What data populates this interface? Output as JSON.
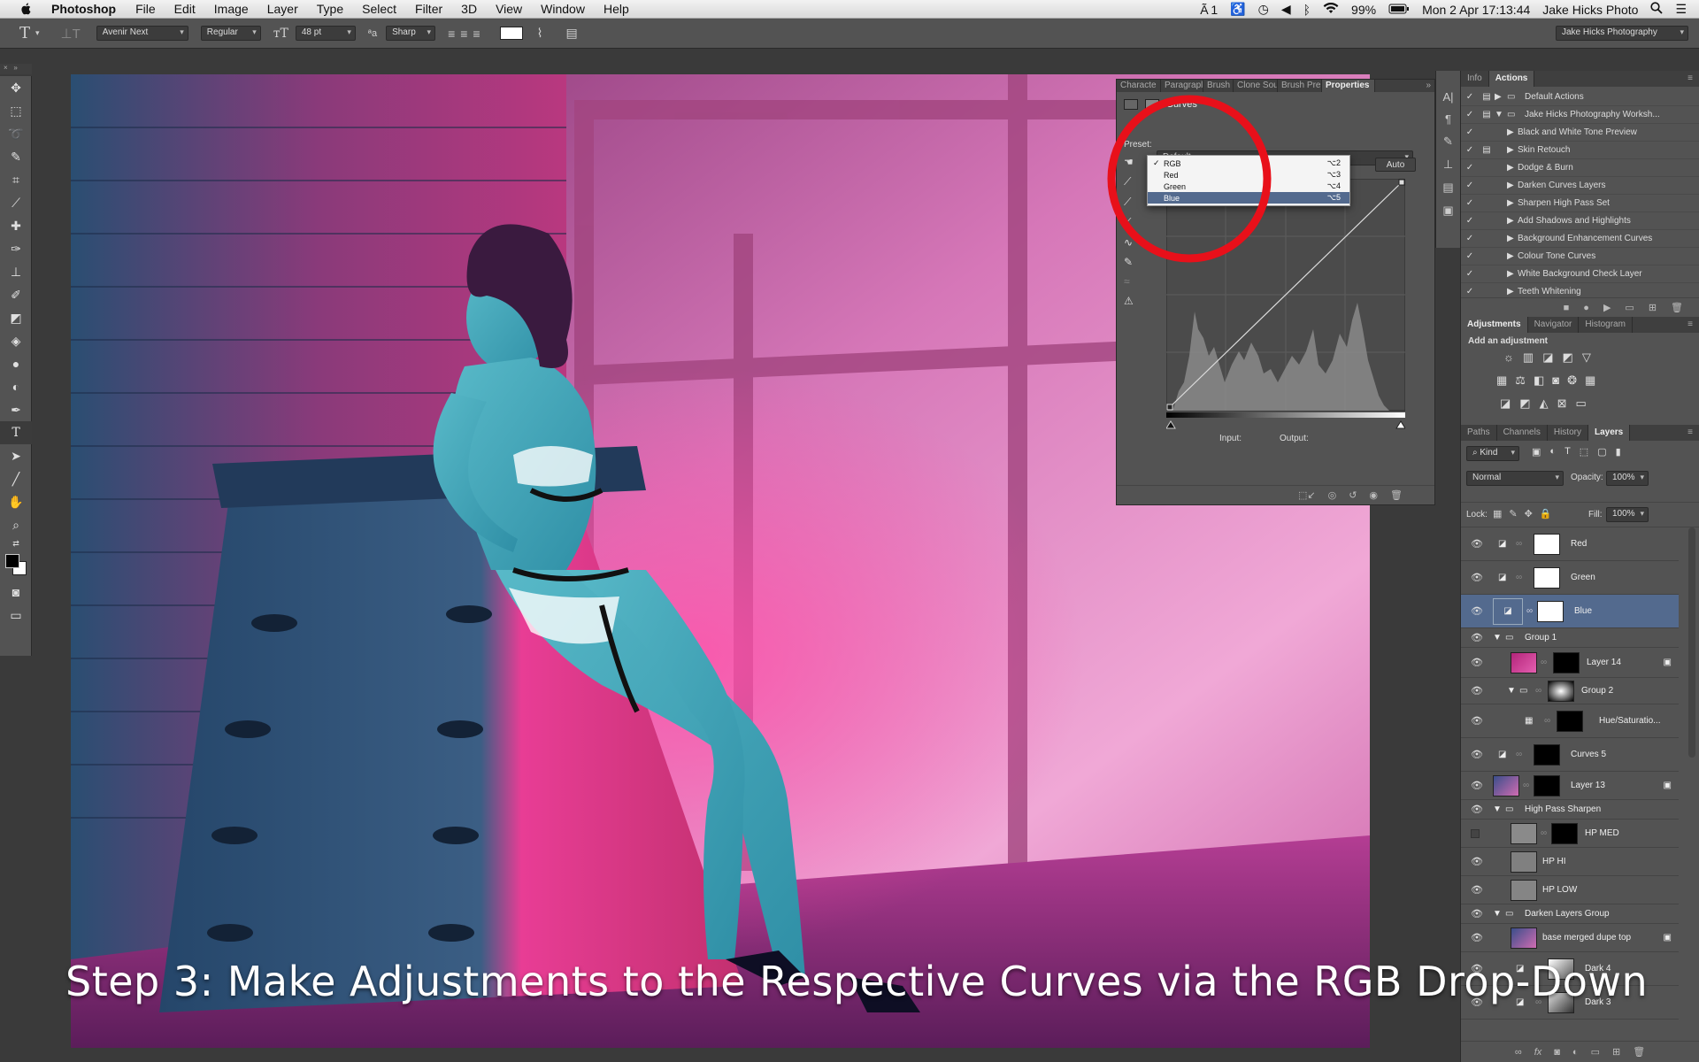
{
  "menubar": {
    "app_name": "Photoshop",
    "items": [
      "File",
      "Edit",
      "Image",
      "Layer",
      "Type",
      "Select",
      "Filter",
      "3D",
      "View",
      "Window",
      "Help"
    ],
    "status": {
      "indicator": "1",
      "battery": "99%",
      "clock": "Mon 2 Apr  17:13:44",
      "user": "Jake Hicks Photo"
    }
  },
  "options_bar": {
    "font_family": "Avenir Next",
    "font_style": "Regular",
    "font_size": "48 pt",
    "aa_label": "ªa",
    "anti_alias": "Sharp",
    "workspace": "Jake Hicks Photography"
  },
  "properties_panel": {
    "tabs": [
      "Characte",
      "Paragrapl",
      "Brush",
      "Clone Sou",
      "Brush Pre",
      "Properties"
    ],
    "active_tab": "Properties",
    "title": "Curves",
    "preset_label": "Preset:",
    "preset_value": "Default",
    "auto_label": "Auto",
    "input_label": "Input:",
    "output_label": "Output:",
    "channel_dropdown": [
      {
        "label": "RGB",
        "shortcut": "⌥2",
        "checked": true
      },
      {
        "label": "Red",
        "shortcut": "⌥3",
        "checked": false
      },
      {
        "label": "Green",
        "shortcut": "⌥4",
        "checked": false
      },
      {
        "label": "Blue",
        "shortcut": "⌥5",
        "checked": false,
        "highlighted": true
      }
    ]
  },
  "actions_panel": {
    "tabs": [
      "Info",
      "Actions"
    ],
    "active_tab": "Actions",
    "items": [
      {
        "label": "Default Actions",
        "kind": "set",
        "expanded": false
      },
      {
        "label": "Jake Hicks Photography Worksh...",
        "kind": "set",
        "expanded": true
      },
      {
        "label": "Black and White Tone Preview",
        "kind": "action"
      },
      {
        "label": "Skin Retouch",
        "kind": "action"
      },
      {
        "label": "Dodge & Burn",
        "kind": "action"
      },
      {
        "label": "Darken Curves Layers",
        "kind": "action"
      },
      {
        "label": "Sharpen High Pass Set",
        "kind": "action"
      },
      {
        "label": "Add Shadows and Highlights",
        "kind": "action"
      },
      {
        "label": "Background Enhancement Curves",
        "kind": "action"
      },
      {
        "label": "Colour Tone Curves",
        "kind": "action"
      },
      {
        "label": "White Background Check Layer",
        "kind": "action"
      },
      {
        "label": "Teeth Whitening",
        "kind": "action"
      }
    ]
  },
  "adjustments_panel": {
    "tabs": [
      "Adjustments",
      "Navigator",
      "Histogram"
    ],
    "active_tab": "Adjustments",
    "heading": "Add an adjustment"
  },
  "layers_panel": {
    "tabs": [
      "Paths",
      "Channels",
      "History",
      "Layers"
    ],
    "active_tab": "Layers",
    "filter": "Kind",
    "blend_mode": "Normal",
    "opacity_label": "Opacity:",
    "opacity": "100%",
    "lock_label": "Lock:",
    "fill_label": "Fill:",
    "fill": "100%",
    "layers": [
      {
        "name": "Red",
        "type": "curves",
        "indent": 0,
        "visible": true
      },
      {
        "name": "Green",
        "type": "curves",
        "indent": 0,
        "visible": true
      },
      {
        "name": "Blue",
        "type": "curves",
        "indent": 0,
        "visible": true,
        "selected": true
      },
      {
        "name": "Group 1",
        "type": "group",
        "indent": 0,
        "visible": true
      },
      {
        "name": "Layer 14",
        "type": "pixel-mask",
        "indent": 1,
        "visible": true
      },
      {
        "name": "Group 2",
        "type": "group",
        "indent": 1,
        "visible": true
      },
      {
        "name": "Hue/Saturatio...",
        "type": "huesat",
        "indent": 2,
        "visible": true
      },
      {
        "name": "Curves 5",
        "type": "curves",
        "indent": 0,
        "visible": true
      },
      {
        "name": "Layer 13",
        "type": "pixel-mask",
        "indent": 0,
        "visible": true
      },
      {
        "name": "High Pass Sharpen",
        "type": "group",
        "indent": 0,
        "visible": true
      },
      {
        "name": "HP MED",
        "type": "pixel-mask",
        "indent": 1,
        "visible": false
      },
      {
        "name": "HP HI",
        "type": "pixel",
        "indent": 1,
        "visible": true
      },
      {
        "name": "HP LOW",
        "type": "pixel",
        "indent": 1,
        "visible": true
      },
      {
        "name": "Darken Layers Group",
        "type": "group",
        "indent": 0,
        "visible": true
      },
      {
        "name": "base merged dupe top",
        "type": "pixel",
        "indent": 1,
        "visible": true
      },
      {
        "name": "Dark 4",
        "type": "curves",
        "indent": 1,
        "visible": true
      },
      {
        "name": "Dark 3",
        "type": "curves",
        "indent": 1,
        "visible": true
      }
    ]
  },
  "caption": "Step 3: Make Adjustments to the Respective Curves via the RGB Drop-Down",
  "colors": {
    "highlight_circle": "#e8101a",
    "selection": "#536a8e",
    "panel": "#535353"
  }
}
